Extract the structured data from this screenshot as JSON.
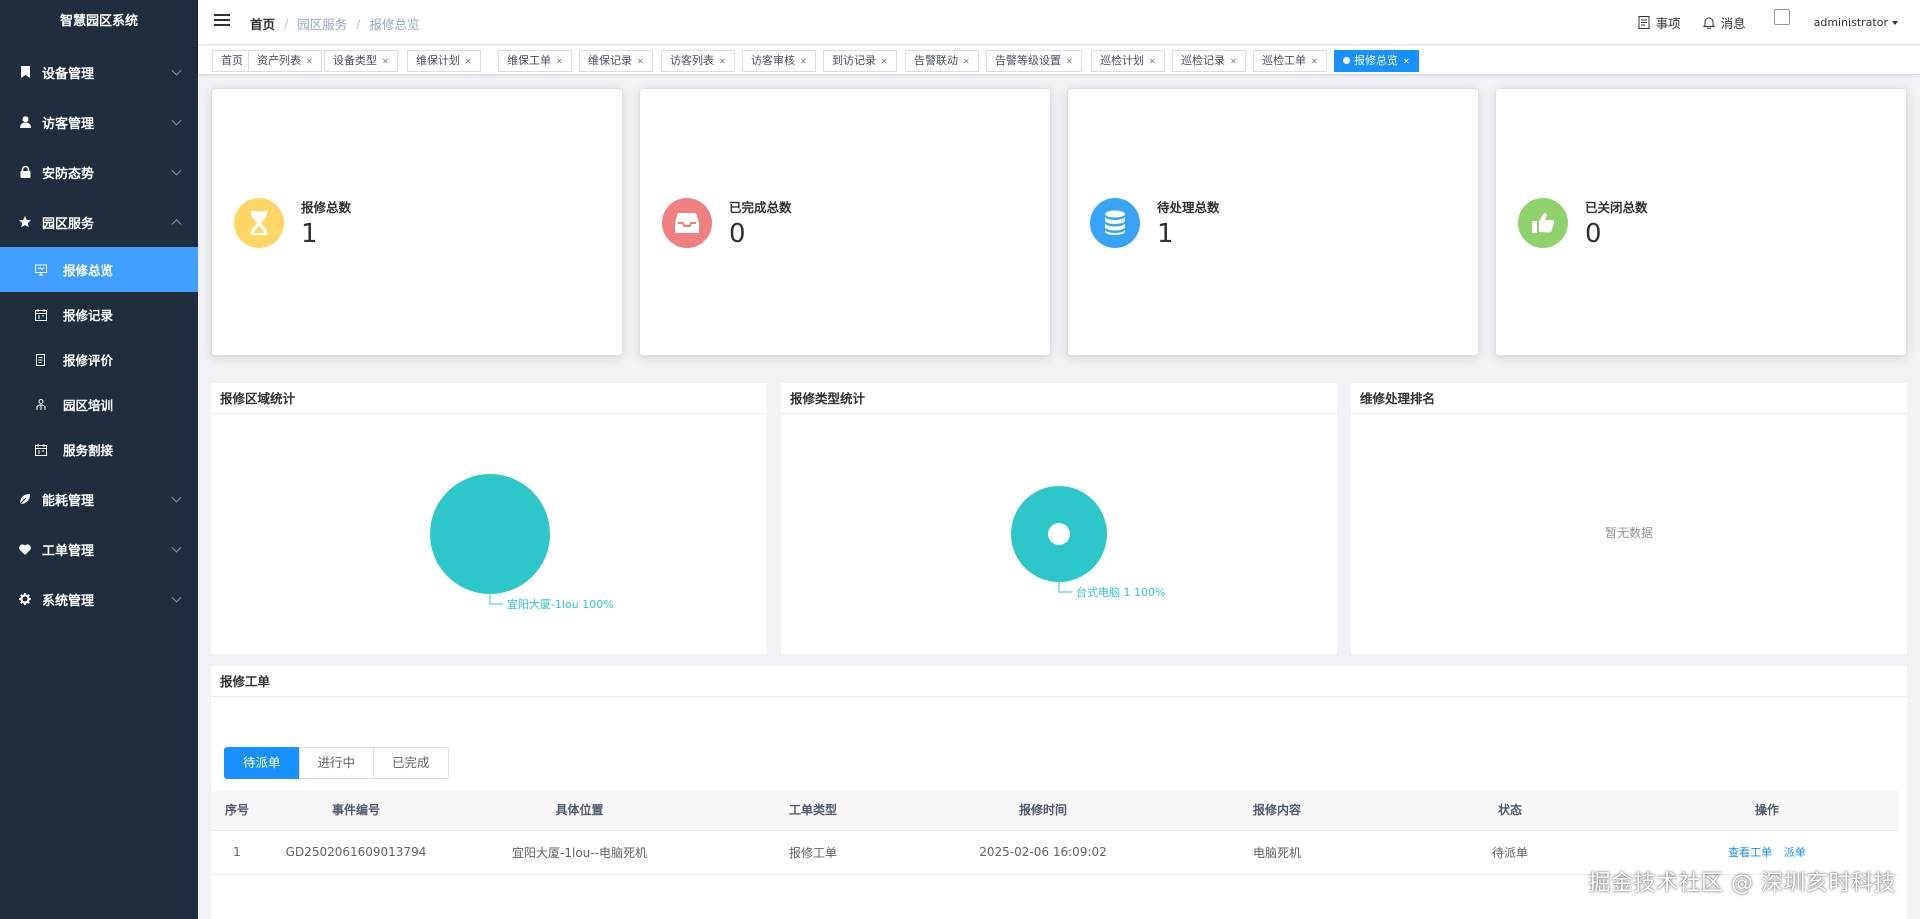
{
  "app": {
    "title": "智慧园区系统"
  },
  "sidebar": {
    "menus": [
      {
        "label": "设备管理",
        "icon": "bookmark-icon"
      },
      {
        "label": "访客管理",
        "icon": "user-icon"
      },
      {
        "label": "安防态势",
        "icon": "lock-icon"
      },
      {
        "label": "园区服务",
        "icon": "star-icon",
        "expanded": true
      },
      {
        "label": "能耗管理",
        "icon": "leaf-icon"
      },
      {
        "label": "工单管理",
        "icon": "heart-icon"
      },
      {
        "label": "系统管理",
        "icon": "gear-icon"
      }
    ],
    "sub_items": [
      {
        "label": "报修总览",
        "icon": "monitor-icon",
        "active": true
      },
      {
        "label": "报修记录",
        "icon": "calendar-icon"
      },
      {
        "label": "报修评价",
        "icon": "list-icon"
      },
      {
        "label": "园区培训",
        "icon": "people-icon"
      },
      {
        "label": "服务割接",
        "icon": "calendar-icon"
      }
    ]
  },
  "header": {
    "breadcrumb": [
      "首页",
      "园区服务",
      "报修总览"
    ],
    "todo_label": "事项",
    "message_label": "消息",
    "username": "administrator"
  },
  "tags": [
    "首页",
    "资产列表",
    "设备类型",
    "维保计划",
    "维保工单",
    "维保记录",
    "访客列表",
    "访客审核",
    "到访记录",
    "告警联动",
    "告警等级设置",
    "巡检计划",
    "巡检记录",
    "巡检工单",
    "报修总览"
  ],
  "stats": [
    {
      "label": "报修总数",
      "value": "1",
      "color": "#ffd666",
      "icon": "hourglass-icon"
    },
    {
      "label": "已完成总数",
      "value": "0",
      "color": "#f08080",
      "icon": "inbox-icon"
    },
    {
      "label": "待处理总数",
      "value": "1",
      "color": "#36a3f7",
      "icon": "database-icon"
    },
    {
      "label": "已关闭总数",
      "value": "0",
      "color": "#8fd16d",
      "icon": "thumbs-up-icon"
    }
  ],
  "panels": {
    "area": {
      "title": "报修区域统计"
    },
    "type": {
      "title": "报修类型统计"
    },
    "ranking": {
      "title": "维修处理排名",
      "empty": "暂无数据"
    }
  },
  "chart_data": [
    {
      "type": "pie",
      "categories": [
        "宜阳大厦-1lou"
      ],
      "values": [
        1
      ],
      "labels": [
        "宜阳大厦-1lou 100%"
      ],
      "color": "#2ec7c9"
    },
    {
      "type": "pie",
      "donut": true,
      "categories": [
        "台式电脑"
      ],
      "values": [
        1
      ],
      "labels": [
        "台式电脑 1 100%"
      ],
      "color": "#2ec7c9"
    }
  ],
  "workorders": {
    "title": "报修工单",
    "tabs": [
      "待派单",
      "进行中",
      "已完成"
    ],
    "columns": [
      "序号",
      "事件编号",
      "具体位置",
      "工单类型",
      "报修时间",
      "报修内容",
      "状态",
      "操作"
    ],
    "rows": [
      {
        "index": "1",
        "code": "GD2502061609013794",
        "location": "宜阳大厦-1lou--电脑死机",
        "type": "报修工单",
        "time": "2025-02-06 16:09:02",
        "content": "电脑死机",
        "status": "待派单",
        "actions": [
          "查看工单",
          "派单"
        ]
      }
    ]
  },
  "watermark": "掘金技术社区 @ 深圳亥时科技"
}
